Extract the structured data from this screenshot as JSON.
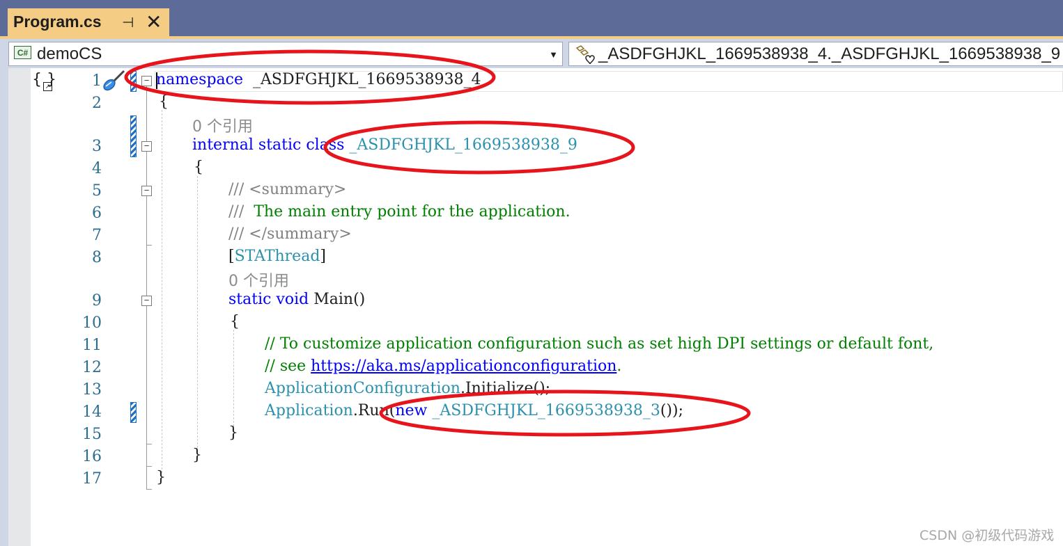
{
  "tab": {
    "title": "Program.cs",
    "pin_glyph": "⊣",
    "close_glyph": "✕"
  },
  "navbar": {
    "project_icon_text": "C#",
    "project": "demoCS",
    "member": "_ASDFGHJKL_1669538938_4._ASDFGHJKL_1669538938_9"
  },
  "editor": {
    "lines": [
      {
        "num": "1",
        "parts": [
          [
            "kw",
            "namespace"
          ],
          [
            "",
            "  _ASDFGHJKL_1669538938_4"
          ]
        ]
      },
      {
        "num": "2",
        "parts": [
          [
            "",
            "{"
          ]
        ]
      },
      {
        "num": "",
        "refs": "0 个引用"
      },
      {
        "num": "3",
        "parts": [
          [
            "kw",
            "internal"
          ],
          [
            "",
            " "
          ],
          [
            "kw",
            "static"
          ],
          [
            "",
            " "
          ],
          [
            "kw",
            "class"
          ],
          [
            "",
            " "
          ],
          [
            "ty",
            "_ASDFGHJKL_1669538938_9"
          ]
        ]
      },
      {
        "num": "4",
        "parts": [
          [
            "",
            "{"
          ]
        ]
      },
      {
        "num": "5",
        "parts": [
          [
            "xml",
            "/// <summary>"
          ]
        ]
      },
      {
        "num": "6",
        "parts": [
          [
            "xml",
            "/// "
          ],
          [
            "cm",
            " The main entry point for the application."
          ]
        ]
      },
      {
        "num": "7",
        "parts": [
          [
            "xml",
            "/// </summary>"
          ]
        ]
      },
      {
        "num": "8",
        "parts": [
          [
            "",
            "["
          ],
          [
            "ty",
            "STAThread"
          ],
          [
            "",
            "]"
          ]
        ]
      },
      {
        "num": "",
        "refs": "0 个引用"
      },
      {
        "num": "9",
        "parts": [
          [
            "kw",
            "static"
          ],
          [
            "",
            " "
          ],
          [
            "kw",
            "void"
          ],
          [
            "",
            " Main()"
          ]
        ]
      },
      {
        "num": "10",
        "parts": [
          [
            "",
            "{"
          ]
        ]
      },
      {
        "num": "11",
        "parts": [
          [
            "cm",
            "// To customize application configuration such as set high DPI settings or default font,"
          ]
        ]
      },
      {
        "num": "12",
        "parts": [
          [
            "cm",
            "// see "
          ],
          [
            "lnk",
            "https://aka.ms/applicationconfiguration"
          ],
          [
            "cm",
            "."
          ]
        ]
      },
      {
        "num": "13",
        "parts": [
          [
            "ty",
            "ApplicationConfiguration"
          ],
          [
            "",
            ".Initialize();"
          ]
        ]
      },
      {
        "num": "14",
        "parts": [
          [
            "ty",
            "Application"
          ],
          [
            "",
            ".Run("
          ],
          [
            "kw",
            "new"
          ],
          [
            "",
            " "
          ],
          [
            "ty",
            "_ASDFGHJKL_1669538938_3"
          ],
          [
            "",
            "());"
          ]
        ]
      },
      {
        "num": "15",
        "parts": [
          [
            "",
            "}"
          ]
        ]
      },
      {
        "num": "16",
        "parts": [
          [
            "",
            "}"
          ]
        ]
      },
      {
        "num": "17",
        "parts": [
          [
            "",
            "}"
          ]
        ]
      }
    ]
  },
  "annotation_color": "#e8141b",
  "watermark": "CSDN @初级代码游戏"
}
